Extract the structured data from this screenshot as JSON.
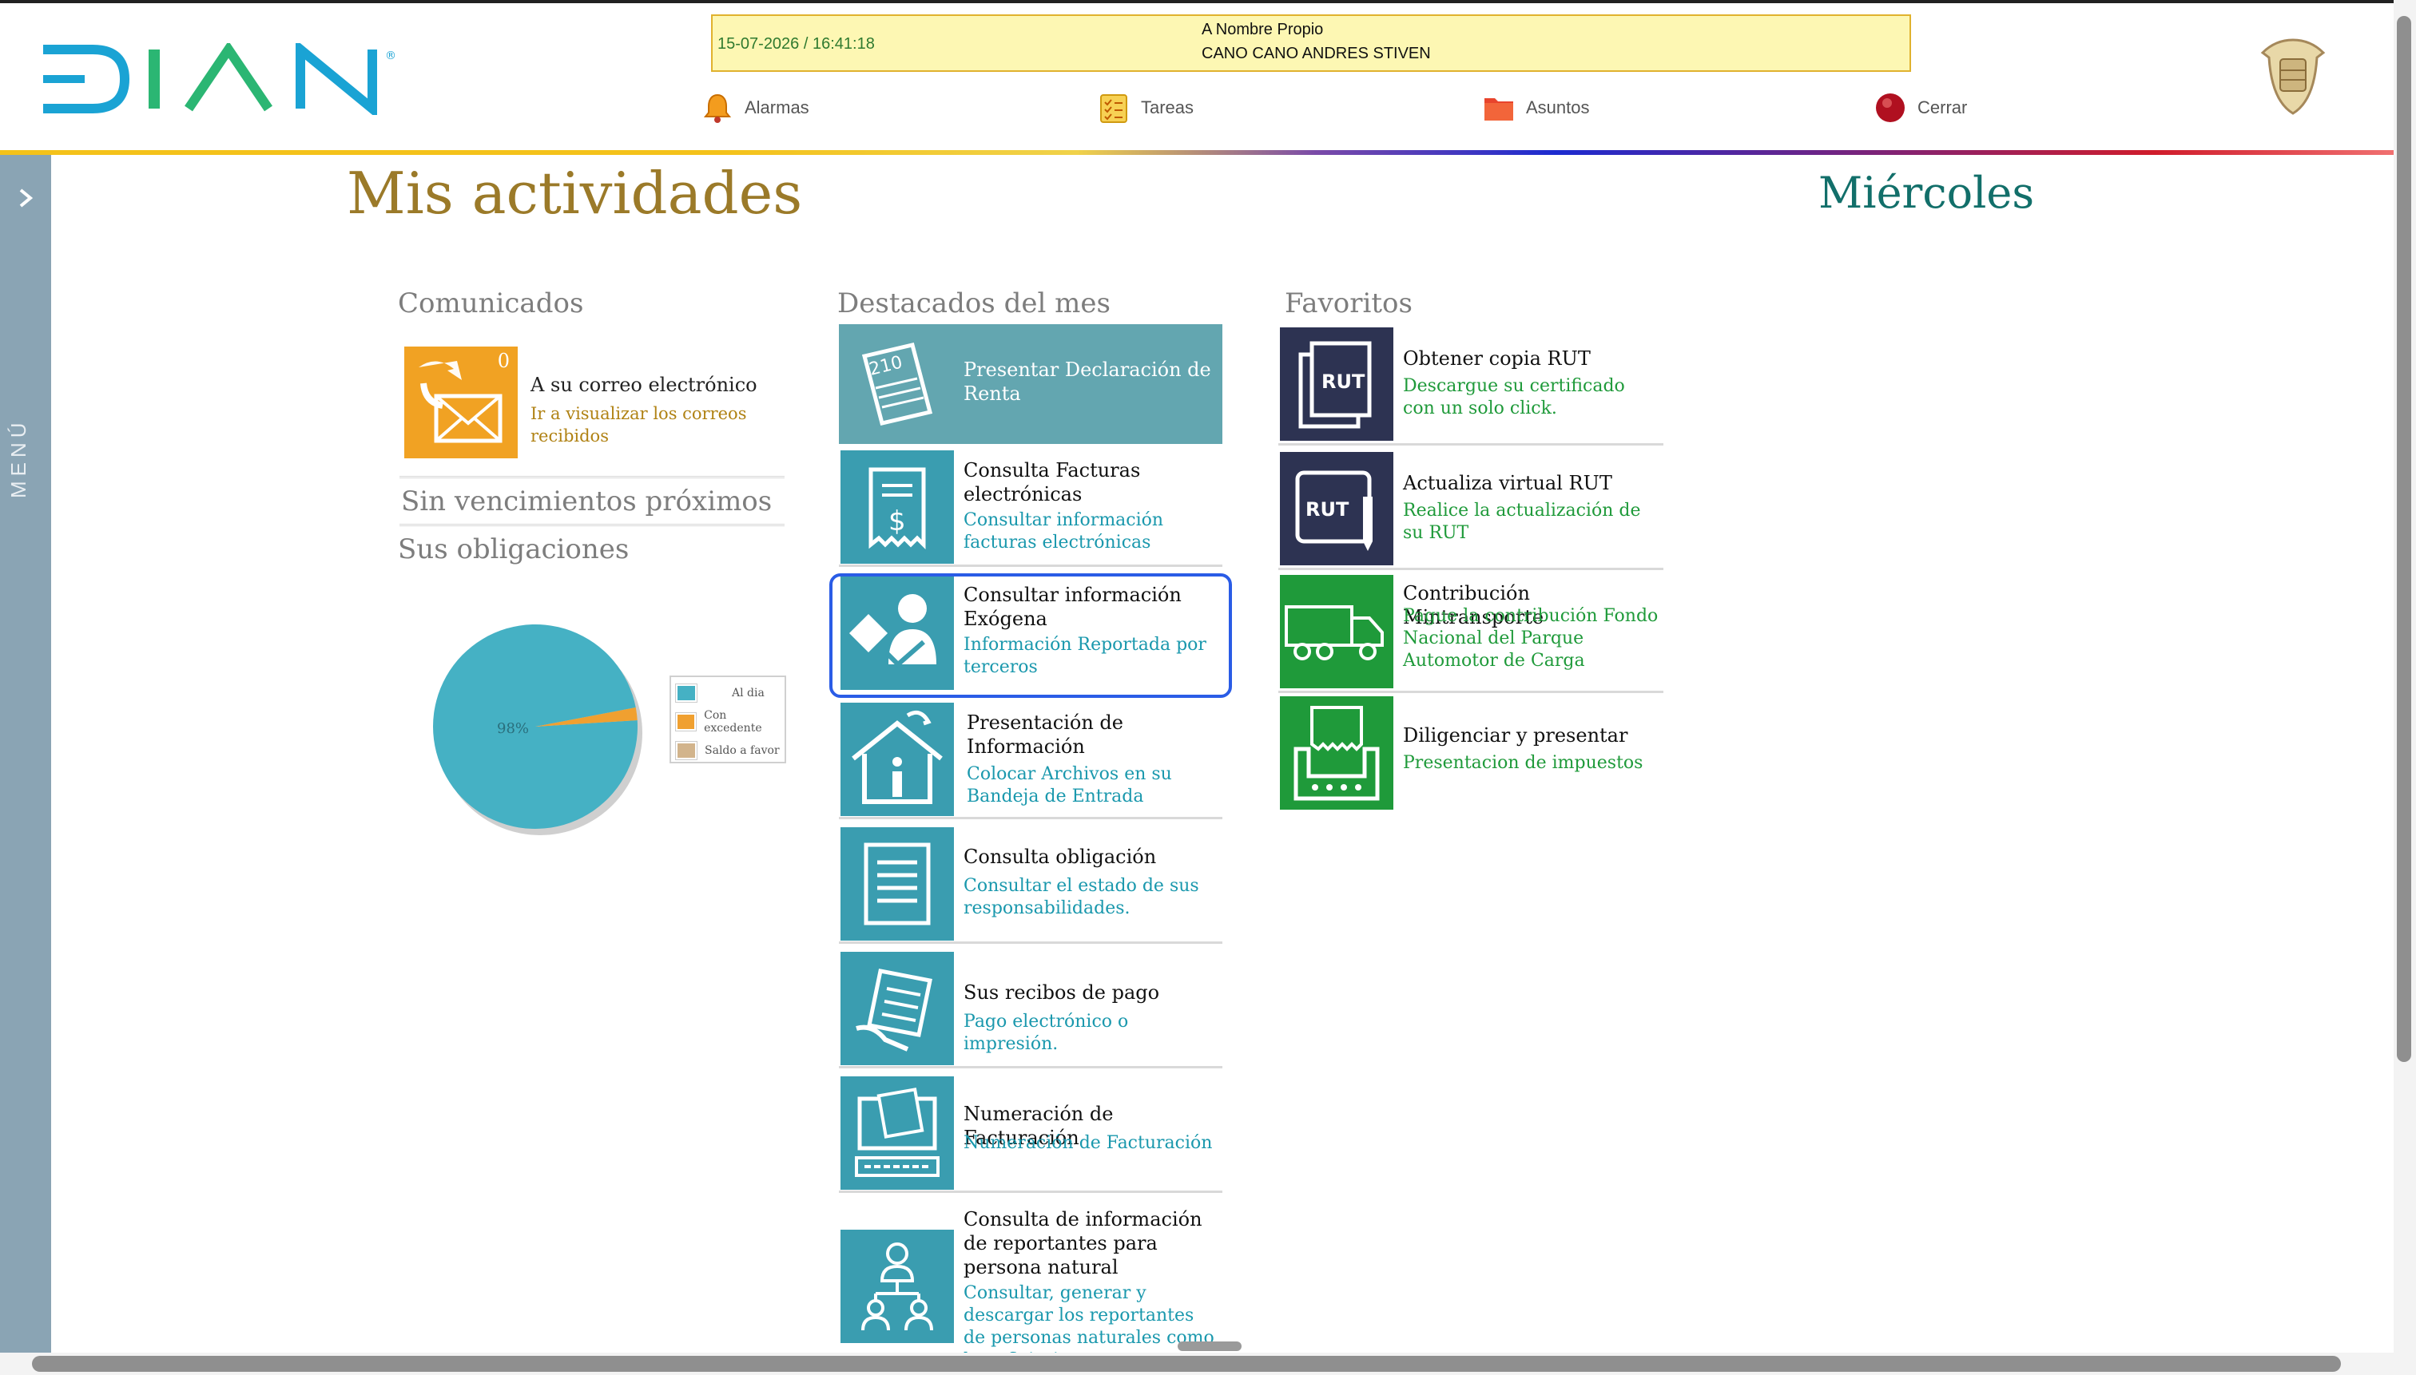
{
  "header": {
    "datetime": "15-07-2026 / 16:41:18",
    "mode_label": "A Nombre Propio",
    "user_name": "CANO CANO ANDRES STIVEN",
    "tools": [
      {
        "label": "Alarmas",
        "icon": "bell-icon"
      },
      {
        "label": "Tareas",
        "icon": "checklist-icon"
      },
      {
        "label": "Asuntos",
        "icon": "folder-icon"
      },
      {
        "label": "Cerrar",
        "icon": "power-icon"
      }
    ]
  },
  "sidemenu": {
    "label": "MENÚ"
  },
  "page": {
    "title": "Mis actividades",
    "day": "Miércoles"
  },
  "comunicados": {
    "title": "Comunicados",
    "count": "0",
    "item_title": "A su correo electrónico",
    "item_sub": "Ir a visualizar los correos recibidos",
    "no_vencimientos": "Sin vencimientos próximos",
    "obligaciones": "Sus obligaciones"
  },
  "chart_data": {
    "type": "pie",
    "labels": [
      "Al dia",
      "Con excedente",
      "Saldo a favor"
    ],
    "values": [
      98,
      2,
      0
    ],
    "colors": [
      "#45b1c4",
      "#f0a030",
      "#d2b48c"
    ],
    "data_label": "98%",
    "legend": "right"
  },
  "destacados": {
    "title": "Destacados del mes",
    "items": [
      {
        "title": "Presentar Declaración de Renta",
        "sub": ""
      },
      {
        "title": "Consulta Facturas electrónicas",
        "sub": "Consultar información facturas electrónicas"
      },
      {
        "title": "Consultar información Exógena",
        "sub": "Información Reportada por terceros"
      },
      {
        "title": "Presentación de Información",
        "sub": "Colocar Archivos en su Bandeja de Entrada"
      },
      {
        "title": "Consulta obligación",
        "sub": "Consultar el estado de sus responsabilidades."
      },
      {
        "title": "Sus recibos de pago",
        "sub": "Pago electrónico o impresión."
      },
      {
        "title": "Numeración de Facturación",
        "sub": "Numeración de Facturación"
      },
      {
        "title": "Consulta de información de reportantes para persona natural",
        "sub": "Consultar, generar y descargar los reportantes de personas naturales como beneficiarios"
      }
    ]
  },
  "favoritos": {
    "title": "Favoritos",
    "items": [
      {
        "title": "Obtener copia RUT",
        "sub": "Descargue su certificado con un solo click.",
        "badge": "RUT"
      },
      {
        "title": "Actualiza virtual RUT",
        "sub": "Realice la actualización de su RUT",
        "badge": "RUT"
      },
      {
        "title": "Contribución Mintransporte",
        "sub": "Pague la contribución Fondo Nacional del Parque Automotor de Carga"
      },
      {
        "title": "Diligenciar y presentar",
        "sub": "Presentacion de impuestos"
      }
    ]
  }
}
